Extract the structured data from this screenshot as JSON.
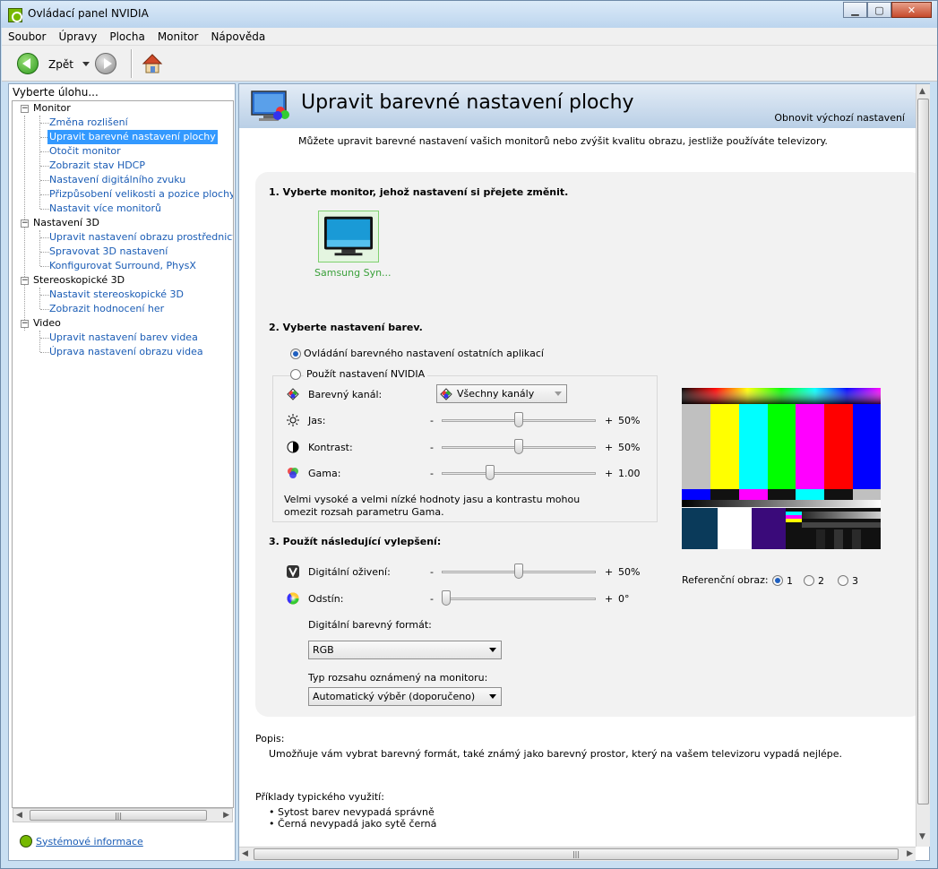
{
  "window": {
    "title": "Ovládací panel NVIDIA",
    "controls": [
      "minimize",
      "maximize",
      "close"
    ]
  },
  "menu": [
    "Soubor",
    "Úpravy",
    "Plocha",
    "Monitor",
    "Nápověda"
  ],
  "toolbar": {
    "back_label": "Zpět"
  },
  "sidebar": {
    "header": "Vyberte úlohu...",
    "tree": [
      {
        "label": "Monitor",
        "type": "category"
      },
      {
        "label": "Změna rozlišení",
        "type": "link"
      },
      {
        "label": "Upravit barevné nastavení plochy",
        "type": "link",
        "selected": true
      },
      {
        "label": "Otočit monitor",
        "type": "link"
      },
      {
        "label": "Zobrazit stav HDCP",
        "type": "link"
      },
      {
        "label": "Nastavení digitálního zvuku",
        "type": "link"
      },
      {
        "label": "Přizpůsobení velikosti a pozice plochy",
        "type": "link"
      },
      {
        "label": "Nastavit více monitorů",
        "type": "link"
      },
      {
        "label": "Nastavení 3D",
        "type": "category"
      },
      {
        "label": "Upravit nastavení obrazu prostřednictvím n",
        "type": "link"
      },
      {
        "label": "Spravovat 3D nastavení",
        "type": "link"
      },
      {
        "label": "Konfigurovat Surround, PhysX",
        "type": "link"
      },
      {
        "label": "Stereoskopické 3D",
        "type": "category"
      },
      {
        "label": "Nastavit stereoskopické 3D",
        "type": "link"
      },
      {
        "label": "Zobrazit hodnocení her",
        "type": "link"
      },
      {
        "label": "Video",
        "type": "category"
      },
      {
        "label": "Upravit nastavení barev videa",
        "type": "link"
      },
      {
        "label": "Úprava nastavení obrazu videa",
        "type": "link"
      }
    ],
    "system_info": "Systémové informace"
  },
  "main": {
    "title": "Upravit barevné nastavení plochy",
    "restore_defaults": "Obnovit výchozí nastavení",
    "intro": "Můžete upravit barevné nastavení vašich monitorů nebo zvýšit kvalitu obrazu, jestliže používáte televizory.",
    "section1": {
      "heading": "1. Vyberte monitor, jehož nastavení si přejete změnit.",
      "monitor_name": "Samsung Syn..."
    },
    "section2": {
      "heading": "2. Vyberte nastavení barev.",
      "radio_other_apps": "Ovládání barevného nastavení ostatních aplikací",
      "radio_nvidia": "Použít nastavení NVIDIA",
      "channel_label": "Barevný kanál:",
      "channel_value": "Všechny kanály",
      "brightness": {
        "label": "Jas:",
        "value": "50%",
        "level": 0.5
      },
      "contrast": {
        "label": "Kontrast:",
        "value": "50%",
        "level": 0.5
      },
      "gamma": {
        "label": "Gama:",
        "value": "1.00",
        "level": 0.3
      },
      "minus": "-",
      "plus": "+",
      "note_line1": "Velmi vysoké a velmi nízké hodnoty jasu a kontrastu mohou",
      "note_line2": "omezit rozsah parametru Gama."
    },
    "section3": {
      "heading": "3. Použít následující vylepšení:",
      "vibrance": {
        "label": "Digitální oživení:",
        "value": "50%",
        "level": 0.5
      },
      "hue": {
        "label": "Odstín:",
        "value": "0°",
        "level": 0.0
      },
      "format_label": "Digitální barevný formát:",
      "format_value": "RGB",
      "range_label": "Typ rozsahu oznámený na monitoru:",
      "range_value": "Automatický výběr (doporučeno)"
    },
    "reference": {
      "label": "Referenční obraz:",
      "options": [
        "1",
        "2",
        "3"
      ],
      "selected": "1"
    },
    "description": {
      "label": "Popis:",
      "text": "Umožňuje vám vybrat barevný formát, také známý jako barevný prostor, který na vašem televizoru vypadá nejlépe.",
      "examples_label": "Příklady typického využití:",
      "examples": [
        "Sytost barev nevypadá správně",
        "Černá nevypadá jako sytě černá"
      ]
    }
  },
  "colors": {
    "accent": "#1a5cb5",
    "selection": "#3399ff",
    "nvidia_green": "#76b900"
  }
}
